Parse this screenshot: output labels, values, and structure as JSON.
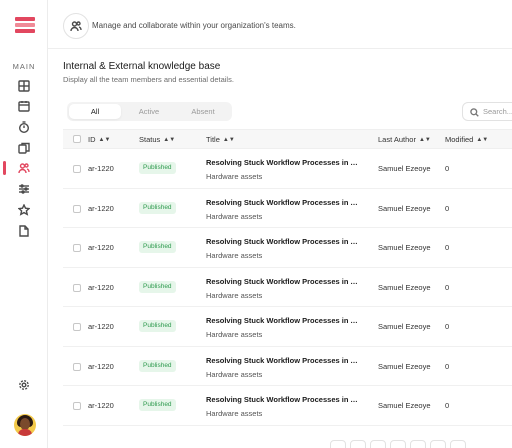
{
  "sidebar": {
    "section_label": "MAIN",
    "items": [
      {
        "name": "grid-icon"
      },
      {
        "name": "calendar-icon"
      },
      {
        "name": "timer-icon"
      },
      {
        "name": "layers-icon"
      },
      {
        "name": "users-icon",
        "active": true
      },
      {
        "name": "sliders-icon"
      },
      {
        "name": "star-icon"
      },
      {
        "name": "document-icon"
      }
    ],
    "settings_icon": "gear-icon",
    "accent": "#e2475f"
  },
  "header": {
    "description": "Manage and collaborate within your organization's teams."
  },
  "kb": {
    "title": "Internal & External knowledge base",
    "subtitle": "Display all the team members and essential details."
  },
  "tabs": [
    "All",
    "Active",
    "Absent"
  ],
  "search": {
    "placeholder": "Search..."
  },
  "table": {
    "columns": {
      "id": "ID",
      "status": "Status",
      "title": "Title",
      "author": "Last Author",
      "modified": "Modified"
    },
    "rows": [
      {
        "id": "ar-1220",
        "status": "Published",
        "title": "Resolving Stuck Workflow Processes in Agl...",
        "subtitle": "Hardware assets",
        "author": "Samuel Ezeoye",
        "modified": "0"
      },
      {
        "id": "ar-1220",
        "status": "Published",
        "title": "Resolving Stuck Workflow Processes in Agl...",
        "subtitle": "Hardware assets",
        "author": "Samuel Ezeoye",
        "modified": "0"
      },
      {
        "id": "ar-1220",
        "status": "Published",
        "title": "Resolving Stuck Workflow Processes in Agl...",
        "subtitle": "Hardware assets",
        "author": "Samuel Ezeoye",
        "modified": "0"
      },
      {
        "id": "ar-1220",
        "status": "Published",
        "title": "Resolving Stuck Workflow Processes in Agl...",
        "subtitle": "Hardware assets",
        "author": "Samuel Ezeoye",
        "modified": "0"
      },
      {
        "id": "ar-1220",
        "status": "Published",
        "title": "Resolving Stuck Workflow Processes in Agl...",
        "subtitle": "Hardware assets",
        "author": "Samuel Ezeoye",
        "modified": "0"
      },
      {
        "id": "ar-1220",
        "status": "Published",
        "title": "Resolving Stuck Workflow Processes in Agl...",
        "subtitle": "Hardware assets",
        "author": "Samuel Ezeoye",
        "modified": "0"
      },
      {
        "id": "ar-1220",
        "status": "Published",
        "title": "Resolving Stuck Workflow Processes in Agl...",
        "subtitle": "Hardware assets",
        "author": "Samuel Ezeoye",
        "modified": "0"
      }
    ]
  }
}
